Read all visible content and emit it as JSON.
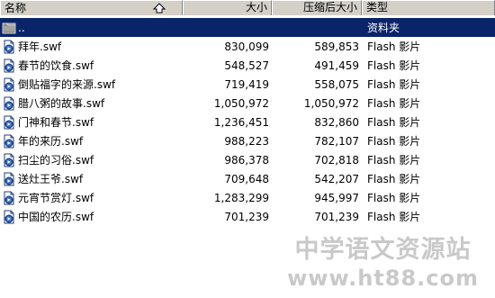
{
  "columns": {
    "name": "名称",
    "size": "大小",
    "compressed": "压缩后大小",
    "type": "类型"
  },
  "parent_row": {
    "name": "..",
    "type": "资料夹"
  },
  "files": [
    {
      "name": "拜年.swf",
      "size": "830,099",
      "compressed": "589,853",
      "type": "Flash 影片"
    },
    {
      "name": "春节的饮食.swf",
      "size": "548,527",
      "compressed": "491,459",
      "type": "Flash 影片"
    },
    {
      "name": "倒贴福字的来源.swf",
      "size": "719,419",
      "compressed": "558,075",
      "type": "Flash 影片"
    },
    {
      "name": "腊八粥的故事.swf",
      "size": "1,050,972",
      "compressed": "1,050,972",
      "type": "Flash 影片"
    },
    {
      "name": "门神和春节.swf",
      "size": "1,236,451",
      "compressed": "832,860",
      "type": "Flash 影片"
    },
    {
      "name": "年的来历.swf",
      "size": "988,223",
      "compressed": "782,107",
      "type": "Flash 影片"
    },
    {
      "name": "扫尘的习俗.swf",
      "size": "986,378",
      "compressed": "702,818",
      "type": "Flash 影片"
    },
    {
      "name": "送灶王爷.swf",
      "size": "709,648",
      "compressed": "542,207",
      "type": "Flash 影片"
    },
    {
      "name": "元宵节赏灯.swf",
      "size": "1,283,299",
      "compressed": "945,997",
      "type": "Flash 影片"
    },
    {
      "name": "中国的农历.swf",
      "size": "701,239",
      "compressed": "701,239",
      "type": "Flash 影片"
    }
  ],
  "watermark": {
    "title": "中学语文资源站",
    "url": "www.ht88.com"
  },
  "colors": {
    "selection": "#0a246a",
    "header": "#d4d0c8",
    "watermark": "#c9c9c9"
  },
  "icons": {
    "sort": "sort-ascending-arrow-icon",
    "parent": "folder-up-icon",
    "file": "flash-movie-file-icon"
  }
}
